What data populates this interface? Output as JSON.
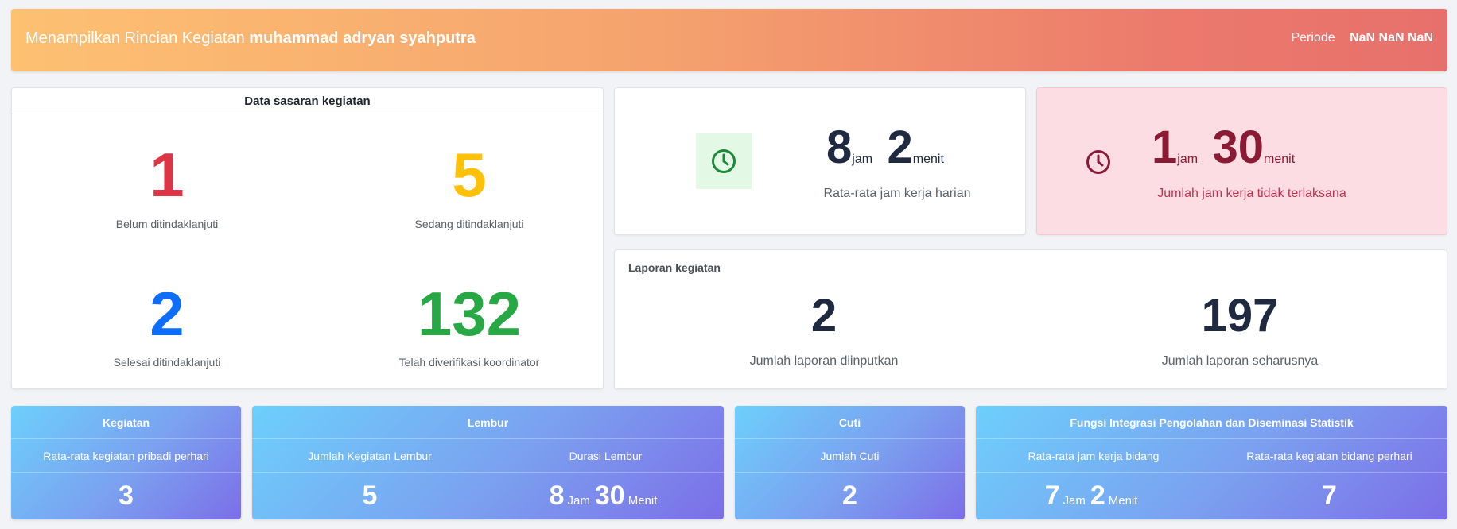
{
  "header": {
    "prefix": "Menampilkan Rincian Kegiatan",
    "name": "muhammad adryan syahputra",
    "period_label": "Periode",
    "period_value": "NaN NaN NaN"
  },
  "sasaran": {
    "title": "Data sasaran kegiatan",
    "belum": {
      "value": "1",
      "label": "Belum ditindaklanjuti",
      "color": "#dc3545"
    },
    "sedang": {
      "value": "5",
      "label": "Sedang ditindaklanjuti",
      "color": "#ffc107"
    },
    "selesai": {
      "value": "2",
      "label": "Selesai ditindaklanjuti",
      "color": "#0d6efd"
    },
    "verifikasi": {
      "value": "132",
      "label": "Telah diverifikasi koordinator",
      "color": "#28a745"
    }
  },
  "rata_jam": {
    "hours": "8",
    "hours_unit": "jam",
    "minutes": "2",
    "minutes_unit": "menit",
    "label": "Rata-rata jam kerja harian",
    "icon": "clock-icon"
  },
  "tidak_terlaksana": {
    "hours": "1",
    "hours_unit": "jam",
    "minutes": "30",
    "minutes_unit": "menit",
    "label": "Jumlah jam kerja tidak terlaksana",
    "icon": "clock-icon"
  },
  "laporan": {
    "title": "Laporan kegiatan",
    "diinput": {
      "value": "2",
      "label": "Jumlah laporan diinputkan"
    },
    "seharusnya": {
      "value": "197",
      "label": "Jumlah laporan seharusnya"
    }
  },
  "kegiatan": {
    "title": "Kegiatan",
    "sub": "Rata-rata kegiatan pribadi perhari",
    "value": "3"
  },
  "lembur": {
    "title": "Lembur",
    "jumlah_label": "Jumlah Kegiatan Lembur",
    "jumlah_value": "5",
    "durasi_label": "Durasi Lembur",
    "durasi_jam": "8",
    "jam_unit": "Jam",
    "durasi_menit": "30",
    "menit_unit": "Menit"
  },
  "cuti": {
    "title": "Cuti",
    "sub": "Jumlah Cuti",
    "value": "2"
  },
  "fungsi": {
    "title": "Fungsi Integrasi Pengolahan dan Diseminasi Statistik",
    "jam_label": "Rata-rata jam kerja bidang",
    "jam_value": "7",
    "jam_unit": "Jam",
    "menit_value": "2",
    "menit_unit": "Menit",
    "kegiatan_label": "Rata-rata kegiatan bidang perhari",
    "kegiatan_value": "7"
  }
}
